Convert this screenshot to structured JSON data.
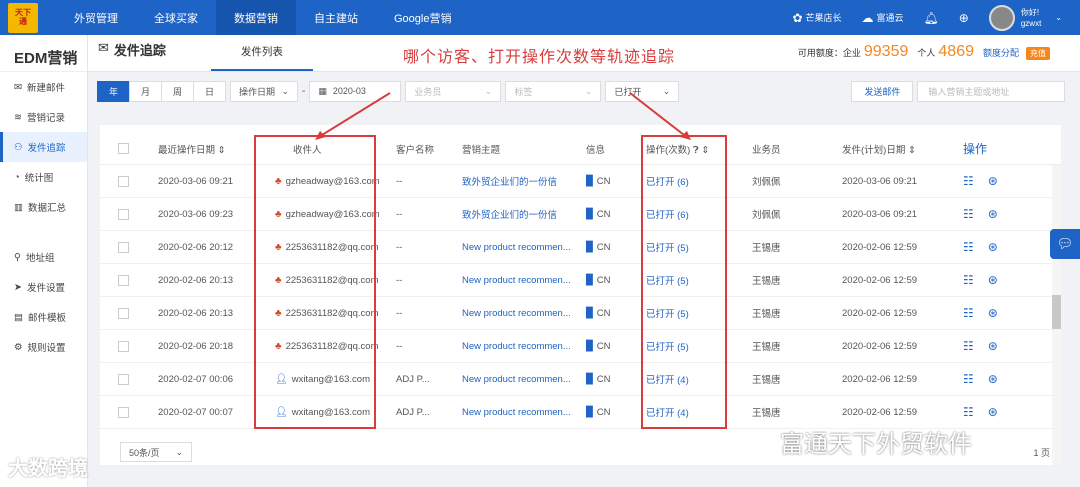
{
  "header": {
    "logo": "天下\n通",
    "nav": [
      "外贸管理",
      "全球买家",
      "数据营销",
      "自主建站",
      "Google营销"
    ],
    "active_nav": 2,
    "mango": "芒果店长",
    "cloud": "富通云",
    "greeting": "你好!",
    "username": "gzwxt"
  },
  "sidebar": {
    "title": "EDM营销",
    "items": [
      {
        "label": "新建邮件",
        "icon": "envelope-icon"
      },
      {
        "label": "营销记录",
        "icon": "layers-icon"
      },
      {
        "label": "发件追踪",
        "icon": "binoculars-icon",
        "active": true
      },
      {
        "label": "统计图",
        "icon": "pie-chart-icon"
      },
      {
        "label": "数据汇总",
        "icon": "bar-chart-icon"
      },
      {
        "label": "地址组",
        "icon": "location-icon"
      },
      {
        "label": "发件设置",
        "icon": "paper-plane-icon"
      },
      {
        "label": "邮件模板",
        "icon": "template-icon"
      },
      {
        "label": "规则设置",
        "icon": "gear-icon"
      }
    ]
  },
  "page": {
    "section_title": "发件追踪",
    "tab": "发件列表",
    "annotation": "哪个访客、打开操作次数等轨迹追踪",
    "quota_label": "可用额度：企业",
    "quota_enterprise": "99359",
    "quota_personal_label": "个人",
    "quota_personal": "4869",
    "quota_link": "额度分配",
    "recharge": "充值"
  },
  "filters": {
    "periods": [
      "年",
      "月",
      "周",
      "日"
    ],
    "date_type": "操作日期",
    "date_value": "2020-03",
    "salesperson_ph": "业务员",
    "tag_ph": "标签",
    "status": "已打开",
    "send_btn": "发送邮件",
    "search_ph": "输入营销主题或地址"
  },
  "table": {
    "columns": [
      "最近操作日期",
      "收件人",
      "客户名称",
      "营销主题",
      "信息",
      "操作(次数)",
      "业务员",
      "发件(计划)日期",
      "操作"
    ],
    "rows": [
      {
        "date": "2020-03-06 09:21",
        "recipient": "gzheadway@163.com",
        "type": "red",
        "customer": "--",
        "subject": "致外贸企业们的一份信",
        "info": "CN",
        "ops": "已打开 (6)",
        "sales": "刘佩佩",
        "send": "2020-03-06 09:21"
      },
      {
        "date": "2020-03-06 09:23",
        "recipient": "gzheadway@163.com",
        "type": "red",
        "customer": "--",
        "subject": "致外贸企业们的一份信",
        "info": "CN",
        "ops": "已打开 (6)",
        "sales": "刘佩佩",
        "send": "2020-03-06 09:21"
      },
      {
        "date": "2020-02-06 20:12",
        "recipient": "2253631182@qq.com",
        "type": "red",
        "customer": "--",
        "subject": "New product recommen...",
        "info": "CN",
        "ops": "已打开 (5)",
        "sales": "王锡唐",
        "send": "2020-02-06 12:59"
      },
      {
        "date": "2020-02-06 20:13",
        "recipient": "2253631182@qq.com",
        "type": "red",
        "customer": "--",
        "subject": "New product recommen...",
        "info": "CN",
        "ops": "已打开 (5)",
        "sales": "王锡唐",
        "send": "2020-02-06 12:59"
      },
      {
        "date": "2020-02-06 20:13",
        "recipient": "2253631182@qq.com",
        "type": "red",
        "customer": "--",
        "subject": "New product recommen...",
        "info": "CN",
        "ops": "已打开 (5)",
        "sales": "王锡唐",
        "send": "2020-02-06 12:59"
      },
      {
        "date": "2020-02-06 20:18",
        "recipient": "2253631182@qq.com",
        "type": "red",
        "customer": "--",
        "subject": "New product recommen...",
        "info": "CN",
        "ops": "已打开 (5)",
        "sales": "王锡唐",
        "send": "2020-02-06 12:59"
      },
      {
        "date": "2020-02-07 00:06",
        "recipient": "wxitang@163.com",
        "type": "blue",
        "customer": "ADJ P...",
        "subject": "New product recommen...",
        "info": "CN",
        "ops": "已打开 (4)",
        "sales": "王锡唐",
        "send": "2020-02-06 12:59"
      },
      {
        "date": "2020-02-07 00:07",
        "recipient": "wxitang@163.com",
        "type": "blue",
        "customer": "ADJ P...",
        "subject": "New product recommen...",
        "info": "CN",
        "ops": "已打开 (4)",
        "sales": "王锡唐",
        "send": "2020-02-06 12:59"
      }
    ]
  },
  "pager": {
    "size": "50条/页",
    "right": "1 页"
  },
  "watermarks": {
    "left": "大数跨境",
    "right": "富通天下外贸软件"
  }
}
